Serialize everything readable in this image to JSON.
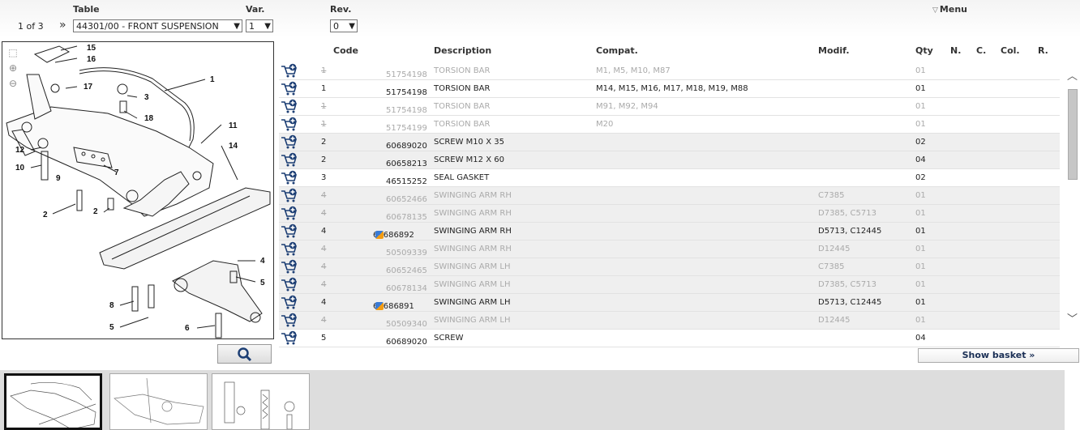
{
  "header": {
    "table_label": "Table",
    "var_label": "Var.",
    "rev_label": "Rev.",
    "menu_label": "Menu",
    "page_info": "1 of 3",
    "nav_symbol": "»",
    "table_value": "44301/00 - FRONT SUSPENSION",
    "var_value": "1",
    "rev_value": "0"
  },
  "columns": {
    "code": "Code",
    "description": "Description",
    "compat": "Compat.",
    "modif": "Modif.",
    "qty": "Qty",
    "n": "N.",
    "c": "C.",
    "col": "Col.",
    "r": "R."
  },
  "rows": [
    {
      "item": "1",
      "code": "51754198",
      "desc": "TORSION BAR",
      "compat": "M1, M5, M10, M87",
      "modif": "",
      "qty": "01",
      "inactive": true
    },
    {
      "item": "1",
      "code": "51754198",
      "desc": "TORSION BAR",
      "compat": "M14, M15, M16, M17, M18, M19, M88",
      "modif": "",
      "qty": "01",
      "inactive": false
    },
    {
      "item": "1",
      "code": "51754198",
      "desc": "TORSION BAR",
      "compat": "M91, M92, M94",
      "modif": "",
      "qty": "01",
      "inactive": true
    },
    {
      "item": "1",
      "code": "51754199",
      "desc": "TORSION BAR",
      "compat": "M20",
      "modif": "",
      "qty": "01",
      "inactive": true
    },
    {
      "item": "2",
      "code": "60689020",
      "desc": "SCREW M10 X 35",
      "compat": "",
      "modif": "",
      "qty": "02",
      "inactive": false
    },
    {
      "item": "2",
      "code": "60658213",
      "desc": "SCREW M12 X 60",
      "compat": "",
      "modif": "",
      "qty": "04",
      "inactive": false
    },
    {
      "item": "3",
      "code": "46515252",
      "desc": "SEAL GASKET",
      "compat": "",
      "modif": "",
      "qty": "02",
      "inactive": false
    },
    {
      "item": "4",
      "code": "60652466",
      "desc": "SWINGING ARM RH",
      "compat": "",
      "modif": "C7385",
      "qty": "01",
      "inactive": true
    },
    {
      "item": "4",
      "code": "60678135",
      "desc": "SWINGING ARM RH",
      "compat": "",
      "modif": "D7385, C5713",
      "qty": "01",
      "inactive": true
    },
    {
      "item": "4",
      "code": "60686892",
      "desc": "SWINGING ARM RH",
      "compat": "",
      "modif": "D5713, C12445",
      "qty": "01",
      "inactive": false,
      "flag": true
    },
    {
      "item": "4",
      "code": "50509339",
      "desc": "SWINGING ARM RH",
      "compat": "",
      "modif": "D12445",
      "qty": "01",
      "inactive": true
    },
    {
      "item": "4",
      "code": "60652465",
      "desc": "SWINGING ARM LH",
      "compat": "",
      "modif": "C7385",
      "qty": "01",
      "inactive": true
    },
    {
      "item": "4",
      "code": "60678134",
      "desc": "SWINGING ARM LH",
      "compat": "",
      "modif": "D7385, C5713",
      "qty": "01",
      "inactive": true
    },
    {
      "item": "4",
      "code": "60686891",
      "desc": "SWINGING ARM LH",
      "compat": "",
      "modif": "D5713, C12445",
      "qty": "01",
      "inactive": false,
      "flag": true
    },
    {
      "item": "4",
      "code": "50509340",
      "desc": "SWINGING ARM LH",
      "compat": "",
      "modif": "D12445",
      "qty": "01",
      "inactive": true
    },
    {
      "item": "5",
      "code": "60689020",
      "desc": "SCREW",
      "compat": "",
      "modif": "",
      "qty": "04",
      "inactive": false
    }
  ],
  "diagram_labels": [
    "15",
    "16",
    "17",
    "1",
    "3",
    "18",
    "11",
    "14",
    "12",
    "10",
    "9",
    "7",
    "2",
    "2",
    "4",
    "5",
    "8",
    "5",
    "6"
  ],
  "basket_button": "Show basket »",
  "icons": {
    "cart": "add-to-cart-icon",
    "search": "search-icon",
    "zoom_in": "zoom-in-icon",
    "zoom_out": "zoom-out-icon"
  }
}
